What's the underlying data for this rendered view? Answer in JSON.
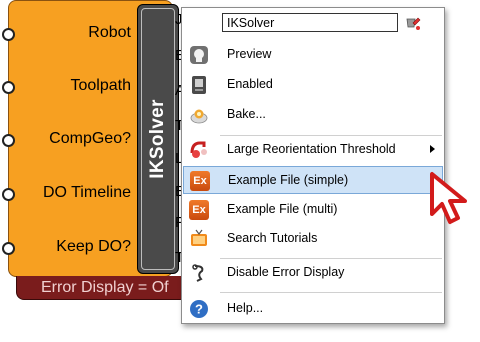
{
  "component": {
    "inputs": [
      "Robot",
      "Toolpath",
      "CompGeo?",
      "DO Timeline",
      "Keep DO?"
    ],
    "name": "IKSolver",
    "output_stubs": [
      "J",
      "E",
      "A",
      "T",
      "L",
      "E",
      "P",
      "T"
    ],
    "error_bar_text": "Error Display = Of"
  },
  "menu": {
    "name_field_value": "IKSolver",
    "items": [
      {
        "label": "Preview",
        "icon": "preview-icon"
      },
      {
        "label": "Enabled",
        "icon": "enabled-icon"
      },
      {
        "label": "Bake...",
        "icon": "bake-icon"
      },
      {
        "label": "Large Reorientation Threshold",
        "icon": "threshold-icon",
        "submenu": true
      },
      {
        "label": "Example File (simple)",
        "icon": "example-file-icon",
        "icon_text": "Ex"
      },
      {
        "label": "Example File (multi)",
        "icon": "example-file-icon",
        "icon_text": "Ex"
      },
      {
        "label": "Search Tutorials",
        "icon": "tutorials-icon"
      },
      {
        "label": "Disable Error Display",
        "icon": "error-display-icon"
      },
      {
        "label": "Help...",
        "icon": "help-icon"
      }
    ],
    "highlighted_item": "Example File (simple)"
  },
  "colors": {
    "component_fill": "#f7a021",
    "name_bar": "#4a4a4a",
    "error_bar": "#7a1c1c",
    "highlight": "#cfe3f7",
    "cursor": "#d21b1b"
  }
}
